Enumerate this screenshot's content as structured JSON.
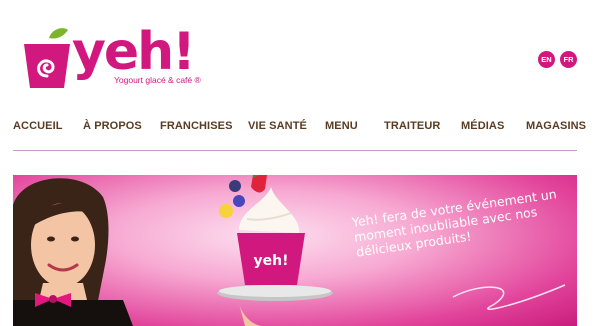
{
  "brand": {
    "name": "yeh!",
    "tagline": "Yogourt glacé & café ®",
    "colors": {
      "accent": "#d1187f",
      "leaf": "#7ab52b",
      "nav_text": "#5a3c22"
    }
  },
  "languages": [
    "EN",
    "FR"
  ],
  "nav": {
    "items": [
      "ACCUEIL",
      "À PROPOS",
      "FRANCHISES",
      "VIE SANTÉ",
      "MENU",
      "TRAITEUR",
      "MÉDIAS",
      "MAGASINS"
    ]
  },
  "banner": {
    "headline": "Yeh! fera de votre événement un moment inoubliable avec nos délicieux produits!",
    "cup_label": "yeh!"
  }
}
